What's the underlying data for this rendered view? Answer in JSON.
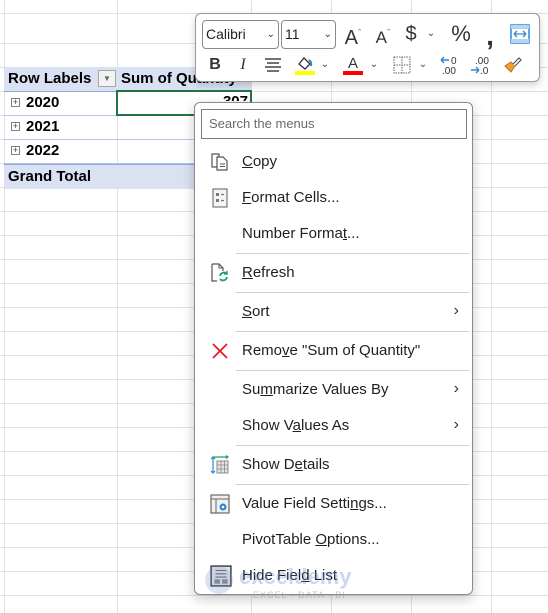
{
  "sheet": {
    "pivot": {
      "header_row_labels": "Row Labels",
      "header_value": "Sum of Quantity",
      "filter_icon": "dropdown-arrow-icon",
      "rows": [
        {
          "label": "2020"
        },
        {
          "label": "2021"
        },
        {
          "label": "2022"
        }
      ],
      "grand_total_label": "Grand Total",
      "selected_value_partial": "307"
    }
  },
  "mini_toolbar": {
    "font_name": "Calibri",
    "font_size": "11",
    "buttons_row1": [
      {
        "name": "increase-font-size",
        "glyph": "Aˆ"
      },
      {
        "name": "decrease-font-size",
        "glyph": "Aˇ"
      },
      {
        "name": "accounting-format",
        "glyph": "$"
      },
      {
        "name": "percent-style",
        "glyph": "%"
      },
      {
        "name": "comma-style",
        "glyph": "’"
      },
      {
        "name": "merge-center",
        "glyph": "⇔"
      }
    ],
    "buttons_row2": [
      {
        "name": "bold",
        "glyph": "B"
      },
      {
        "name": "italic",
        "glyph": "I"
      },
      {
        "name": "center-align",
        "glyph": "≡"
      },
      {
        "name": "fill-color",
        "glyph": "◇"
      },
      {
        "name": "font-color",
        "glyph": "A"
      },
      {
        "name": "borders",
        "glyph": "⊞"
      },
      {
        "name": "increase-decimal",
        "glyph": "←.0"
      },
      {
        "name": "decrease-decimal",
        "glyph": ".00→"
      },
      {
        "name": "format-painter",
        "glyph": "✎"
      }
    ],
    "colors": {
      "fill": "#ffff00",
      "font": "#ff0000",
      "accent": "#2b88d8",
      "painter": "#f0a030"
    }
  },
  "context_menu": {
    "search_placeholder": "Search the menus",
    "items": [
      {
        "label_pre": "",
        "label_u": "C",
        "label_post": "opy",
        "icon": "copy-icon"
      },
      {
        "label_pre": "",
        "label_u": "F",
        "label_post": "ormat Cells...",
        "icon": "format-cells-icon"
      },
      {
        "label_pre": "Number Forma",
        "label_u": "t",
        "label_post": "...",
        "icon": ""
      },
      {
        "label_pre": "",
        "label_u": "R",
        "label_post": "efresh",
        "icon": "refresh-icon"
      },
      {
        "label_pre": "",
        "label_u": "S",
        "label_post": "ort",
        "icon": "",
        "submenu": true
      },
      {
        "label_pre": "Remo",
        "label_u": "v",
        "label_post": "e \"Sum of Quantity\"",
        "icon": "remove-icon"
      },
      {
        "label_pre": "Su",
        "label_u": "m",
        "label_post": "marize Values By",
        "icon": "",
        "submenu": true
      },
      {
        "label_pre": "Show V",
        "label_u": "a",
        "label_post": "lues As",
        "icon": "",
        "submenu": true
      },
      {
        "label_pre": "Show D",
        "label_u": "e",
        "label_post": "tails",
        "icon": "show-details-icon"
      },
      {
        "label_pre": "Value Field Setti",
        "label_u": "n",
        "label_post": "gs...",
        "icon": "value-field-settings-icon"
      },
      {
        "label_pre": "PivotTable ",
        "label_u": "O",
        "label_post": "ptions...",
        "icon": ""
      },
      {
        "label_pre": "Hide Fiel",
        "label_u": "d",
        "label_post": " List",
        "icon": "field-list-icon"
      }
    ],
    "submenu_arrow": "›",
    "remove_color": "#e81123"
  },
  "watermark": {
    "title": "exceldemy",
    "subtitle": "EXCEL - DATA - BI"
  }
}
